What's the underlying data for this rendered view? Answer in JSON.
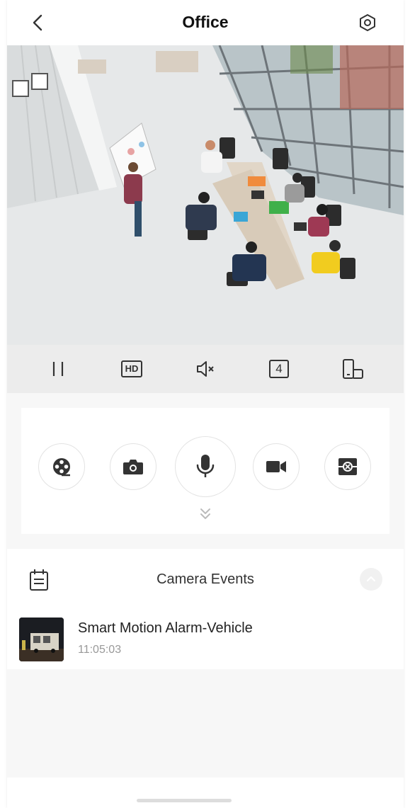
{
  "header": {
    "title": "Office",
    "back_icon": "chevron-left-icon",
    "settings_icon": "hexagon-settings-icon"
  },
  "video": {
    "description_icon": "live-camera-feed"
  },
  "controls": {
    "pause_icon": "pause-icon",
    "hd_label": "HD",
    "mute_icon": "speaker-muted-icon",
    "split_label": "4",
    "orientation_icon": "rotate-device-icon"
  },
  "actions": {
    "items": [
      "film-reel-icon",
      "camera-icon",
      "microphone-icon",
      "video-record-icon",
      "cruise-icon"
    ],
    "expand_icon": "double-chevron-down-icon"
  },
  "events": {
    "title": "Camera Events",
    "calendar_icon": "calendar-icon",
    "collapse_icon": "chevron-up-icon",
    "list": [
      {
        "title": "Smart Motion Alarm-Vehicle",
        "time": "11:05:03"
      }
    ]
  },
  "colors": {
    "icon": "#333333",
    "muted": "#999999",
    "control_bar": "#ececec"
  }
}
